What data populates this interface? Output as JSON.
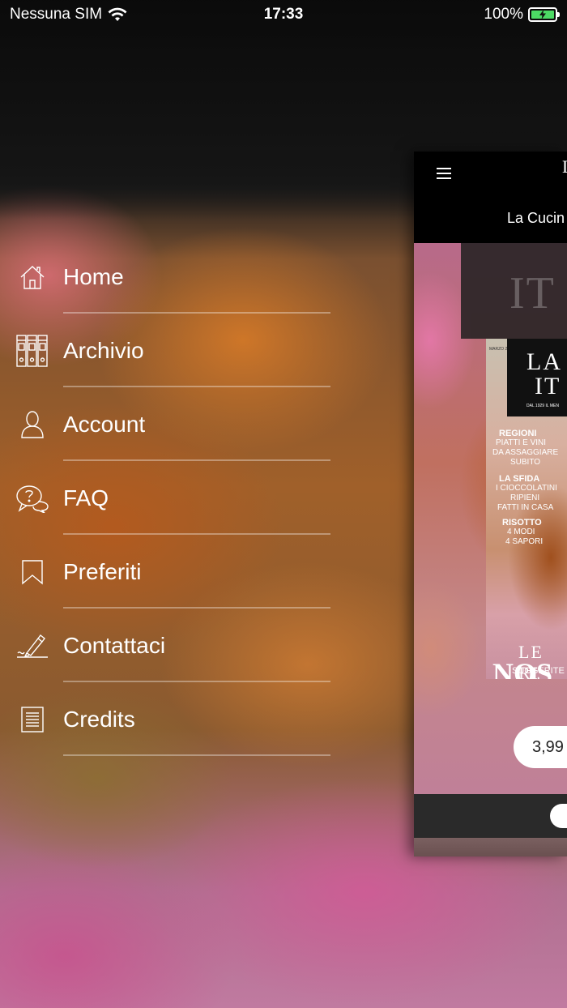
{
  "status_bar": {
    "carrier": "Nessuna SIM",
    "time": "17:33",
    "battery": "100%",
    "wifi_icon": "wifi-icon",
    "battery_icon": "battery-charging-icon"
  },
  "menu": {
    "items": [
      {
        "label": "Home",
        "icon": "home-icon"
      },
      {
        "label": "Archivio",
        "icon": "archive-binders-icon"
      },
      {
        "label": "Account",
        "icon": "user-icon"
      },
      {
        "label": "FAQ",
        "icon": "question-bubbles-icon"
      },
      {
        "label": "Preferiti",
        "icon": "bookmark-icon"
      },
      {
        "label": "Contattaci",
        "icon": "pen-sign-icon"
      },
      {
        "label": "Credits",
        "icon": "document-icon"
      }
    ]
  },
  "main_preview": {
    "nav_logo": "L",
    "nav_title": "La Cucin",
    "price": "3,99",
    "cover": {
      "month": "MARZO 2021",
      "masthead_1": "LA",
      "masthead_2": "IT",
      "since": "DAL 1929 IL MEN",
      "regioni_title": "REGIONI",
      "regioni_1": "PIATTI E VINI",
      "regioni_2": "DA ASSAGGIARE",
      "regioni_3": "SUBITO",
      "sfida_title": "LA SFIDA",
      "sfida_1": "I CIOCCOLATINI",
      "sfida_2": "RIPIENI",
      "sfida_3": "FATTI IN CASA",
      "risotto_title": "RISOTTO",
      "risotto_1": "4 MODI",
      "risotto_2": "4 SAPORI",
      "le": "LE RI",
      "nos": "NOS",
      "sugg": "SUGGERITE D"
    }
  },
  "colors": {
    "accent_battery": "#4cd964",
    "menu_text": "#ffffff",
    "divider": "rgba(255,255,255,0.35)"
  }
}
